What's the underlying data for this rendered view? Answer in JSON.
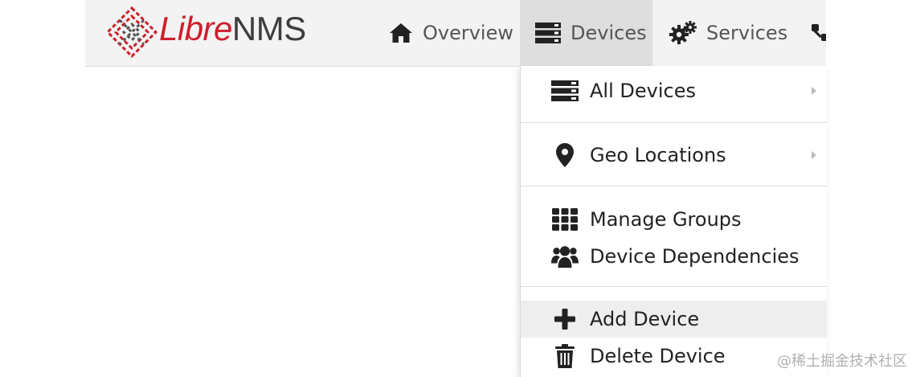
{
  "brand": {
    "part1": "Libre",
    "part2": "NMS"
  },
  "nav": {
    "items": [
      {
        "label": "Overview",
        "icon": "home-icon"
      },
      {
        "label": "Devices",
        "icon": "server-icon",
        "active": true
      },
      {
        "label": "Services",
        "icon": "cogs-icon"
      }
    ]
  },
  "devices_menu": {
    "items": [
      {
        "label": "All Devices",
        "icon": "server-icon",
        "submenu": true
      },
      {
        "label": "Geo Locations",
        "icon": "map-marker-icon",
        "submenu": true
      },
      {
        "label": "Manage Groups",
        "icon": "th-grid-icon"
      },
      {
        "label": "Device Dependencies",
        "icon": "users-icon"
      },
      {
        "label": "Add Device",
        "icon": "plus-icon",
        "hovered": true
      },
      {
        "label": "Delete Device",
        "icon": "trash-icon"
      }
    ]
  },
  "colors": {
    "brand_red": "#cf1f2b",
    "navbar_bg": "#f3f3f3",
    "active_bg": "#dedede"
  },
  "watermark": "@稀土掘金技术社区"
}
